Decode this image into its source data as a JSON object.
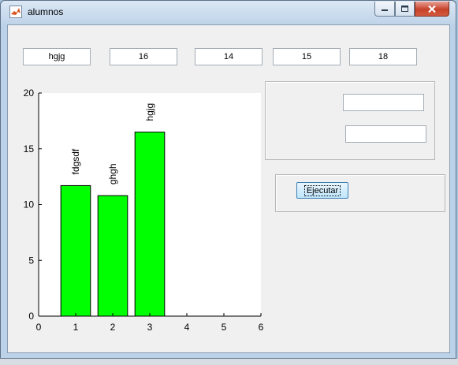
{
  "window": {
    "title": "alumnos",
    "app_icon": "matlab-icon"
  },
  "fields": {
    "name": "hgjg",
    "f1": "16",
    "f2": "14",
    "f3": "15",
    "f4": "18"
  },
  "button": {
    "run_label": "Ejecutar"
  },
  "chart_data": {
    "type": "bar",
    "x": [
      1,
      2,
      3
    ],
    "values": [
      11.7,
      10.8,
      16.5
    ],
    "bar_labels": [
      "fdgsdf",
      "ghgh",
      "hgjg"
    ],
    "xlim": [
      0,
      6
    ],
    "ylim": [
      0,
      20
    ],
    "xticks": [
      "0",
      "1",
      "2",
      "3",
      "4",
      "5",
      "6"
    ],
    "yticks": [
      "0",
      "5",
      "10",
      "15",
      "20"
    ],
    "bar_color": "#00ff00"
  }
}
